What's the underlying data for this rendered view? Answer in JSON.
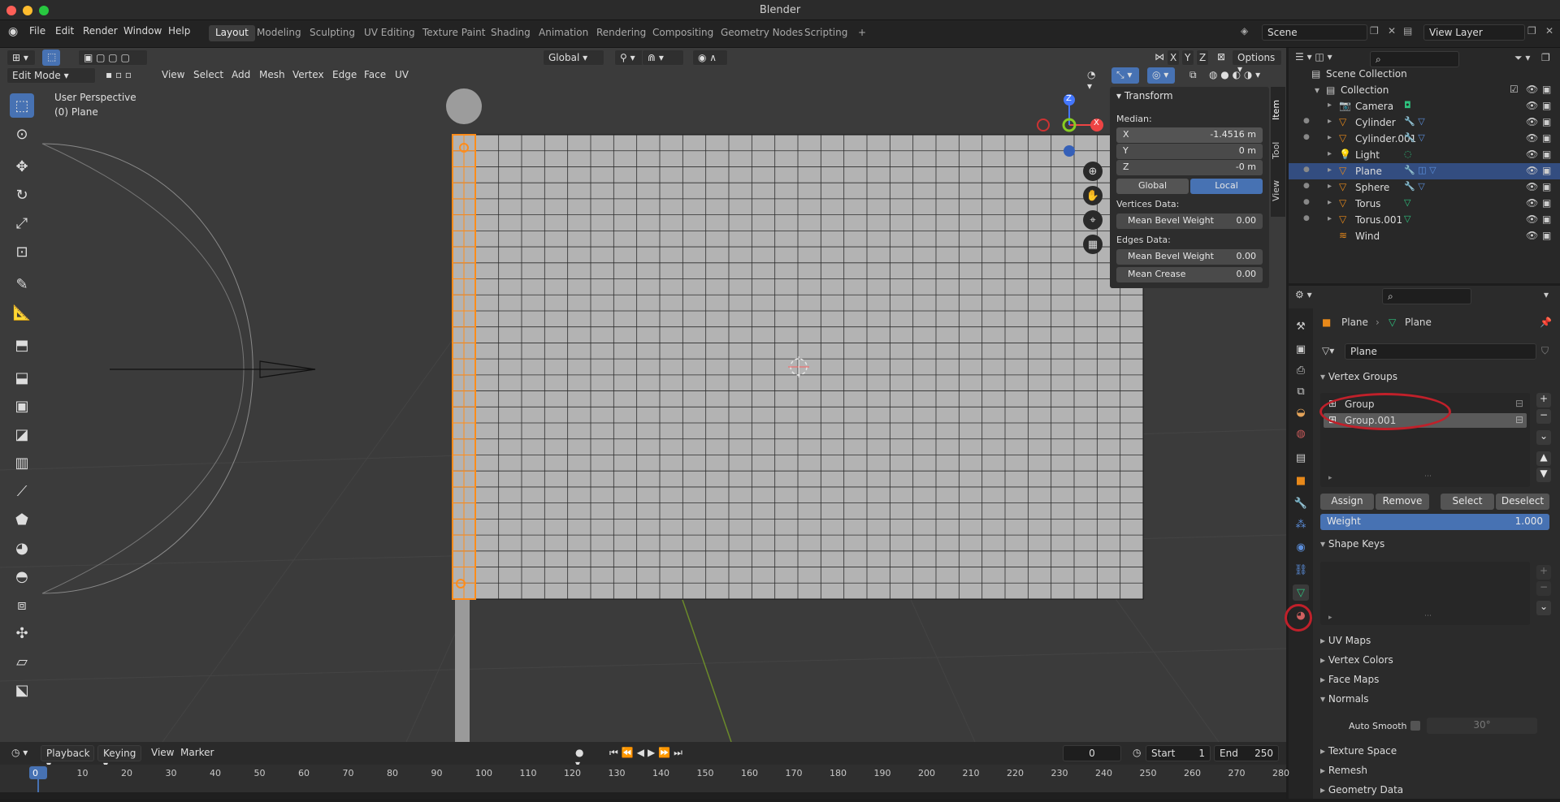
{
  "window": {
    "title": "Blender"
  },
  "menus": [
    "File",
    "Edit",
    "Render",
    "Window",
    "Help"
  ],
  "workspaces": [
    "Layout",
    "Modeling",
    "Sculpting",
    "UV Editing",
    "Texture Paint",
    "Shading",
    "Animation",
    "Rendering",
    "Compositing",
    "Geometry Nodes",
    "Scripting"
  ],
  "scene": {
    "name": "Scene",
    "view_layer": "View Layer"
  },
  "viewport": {
    "mode": "Edit Mode",
    "menus": [
      "View",
      "Select",
      "Add",
      "Mesh",
      "Vertex",
      "Edge",
      "Face",
      "UV"
    ],
    "orientation": "Global",
    "options": "Options",
    "axes": [
      "X",
      "Y",
      "Z"
    ],
    "overlay_title": "User Perspective",
    "overlay_object": "(0) Plane",
    "gizmo": {
      "x": "X",
      "z": "Z"
    }
  },
  "npanel": {
    "title": "Transform",
    "median_label": "Median:",
    "x_label": "X",
    "x_value": "-1.4516 m",
    "y_label": "Y",
    "y_value": "0 m",
    "z_label": "Z",
    "z_value": "-0 m",
    "global": "Global",
    "local": "Local",
    "vertices_data": "Vertices Data:",
    "mean_bevel_weight_label": "Mean Bevel Weight",
    "mean_bevel_weight_v": "0.00",
    "edges_data": "Edges Data:",
    "mean_bevel_weight_e": "0.00",
    "mean_crease_label": "Mean Crease",
    "mean_crease": "0.00",
    "tabs": [
      "Item",
      "Tool",
      "View"
    ]
  },
  "outliner": {
    "scene_collection": "Scene Collection",
    "collection": "Collection",
    "items": [
      "Camera",
      "Cylinder",
      "Cylinder.001",
      "Light",
      "Plane",
      "Sphere",
      "Torus",
      "Torus.001",
      "Wind"
    ]
  },
  "properties": {
    "breadcrumb_object": "Plane",
    "breadcrumb_mesh": "Plane",
    "mesh_name": "Plane",
    "vertex_groups_title": "Vertex Groups",
    "groups": [
      "Group",
      "Group.001"
    ],
    "assign": "Assign",
    "remove": "Remove",
    "select": "Select",
    "deselect": "Deselect",
    "weight_label": "Weight",
    "weight_value": "1.000",
    "shape_keys": "Shape Keys",
    "uv_maps": "UV Maps",
    "vertex_colors": "Vertex Colors",
    "face_maps": "Face Maps",
    "normals": "Normals",
    "auto_smooth": "Auto Smooth",
    "auto_smooth_angle": "30°",
    "texture_space": "Texture Space",
    "remesh": "Remesh",
    "geometry_data": "Geometry Data"
  },
  "timeline": {
    "menus": [
      "Playback",
      "Keying",
      "View",
      "Marker"
    ],
    "current": "0",
    "start_label": "Start",
    "start": "1",
    "end_label": "End",
    "end": "250",
    "frames": [
      "0",
      "10",
      "20",
      "30",
      "40",
      "50",
      "60",
      "70",
      "80",
      "90",
      "100",
      "110",
      "120",
      "130",
      "140",
      "150",
      "160",
      "170",
      "180",
      "190",
      "200",
      "210",
      "220",
      "230",
      "240",
      "250",
      "260",
      "270",
      "280"
    ]
  },
  "colors": {
    "accent": "#4772b3",
    "selected_vertex": "#ff8c1a",
    "annotation": "#c0202a"
  }
}
